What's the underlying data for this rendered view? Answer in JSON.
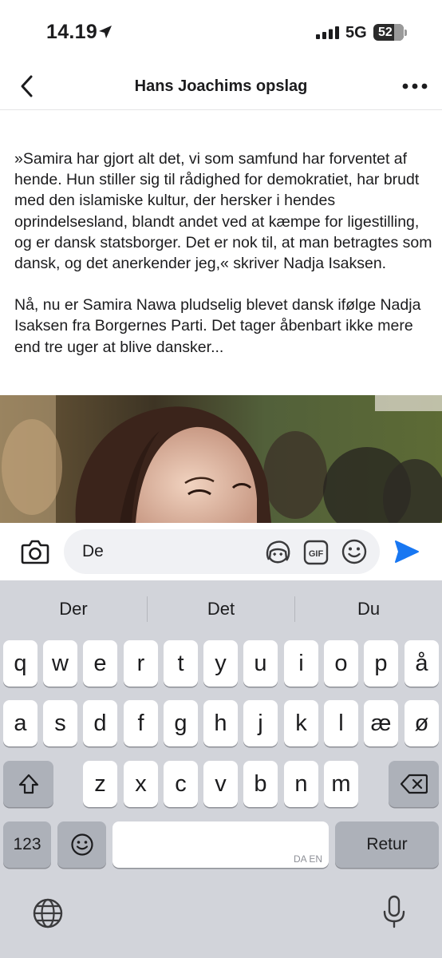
{
  "status_bar": {
    "time": "14.19",
    "network": "5G",
    "battery": "52"
  },
  "nav": {
    "title": "Hans Joachims opslag"
  },
  "post": {
    "paragraphs": [
      "»Samira har gjort alt det, vi som samfund har forventet af hende. Hun stiller sig til rådighed for demokratiet, har brudt med den islamiske kultur, der hersker i hendes oprindelsesland, blandt andet ved at kæmpe for ligestilling, og er dansk statsborger. Det er nok til, at man betragtes som dansk, og det anerkender jeg,« skriver Nadja Isaksen.",
      "Nå, nu er Samira Nawa pludselig blevet dansk ifølge Nadja Isaksen fra Borgernes Parti. Det tager åbenbart ikke mere end tre uger at blive dansker..."
    ]
  },
  "comment": {
    "value": "De"
  },
  "keyboard": {
    "suggestions": [
      "Der",
      "Det",
      "Du"
    ],
    "row1": [
      "q",
      "w",
      "e",
      "r",
      "t",
      "y",
      "u",
      "i",
      "o",
      "p",
      "å"
    ],
    "row2": [
      "a",
      "s",
      "d",
      "f",
      "g",
      "h",
      "j",
      "k",
      "l",
      "æ",
      "ø"
    ],
    "row3": [
      "z",
      "x",
      "c",
      "v",
      "b",
      "n",
      "m"
    ],
    "numbers_label": "123",
    "space_hint": "DA EN",
    "return_label": "Retur"
  },
  "colors": {
    "accent": "#1877f2",
    "keyboard_bg": "#d2d4da",
    "key_dark": "#adb1b9"
  }
}
